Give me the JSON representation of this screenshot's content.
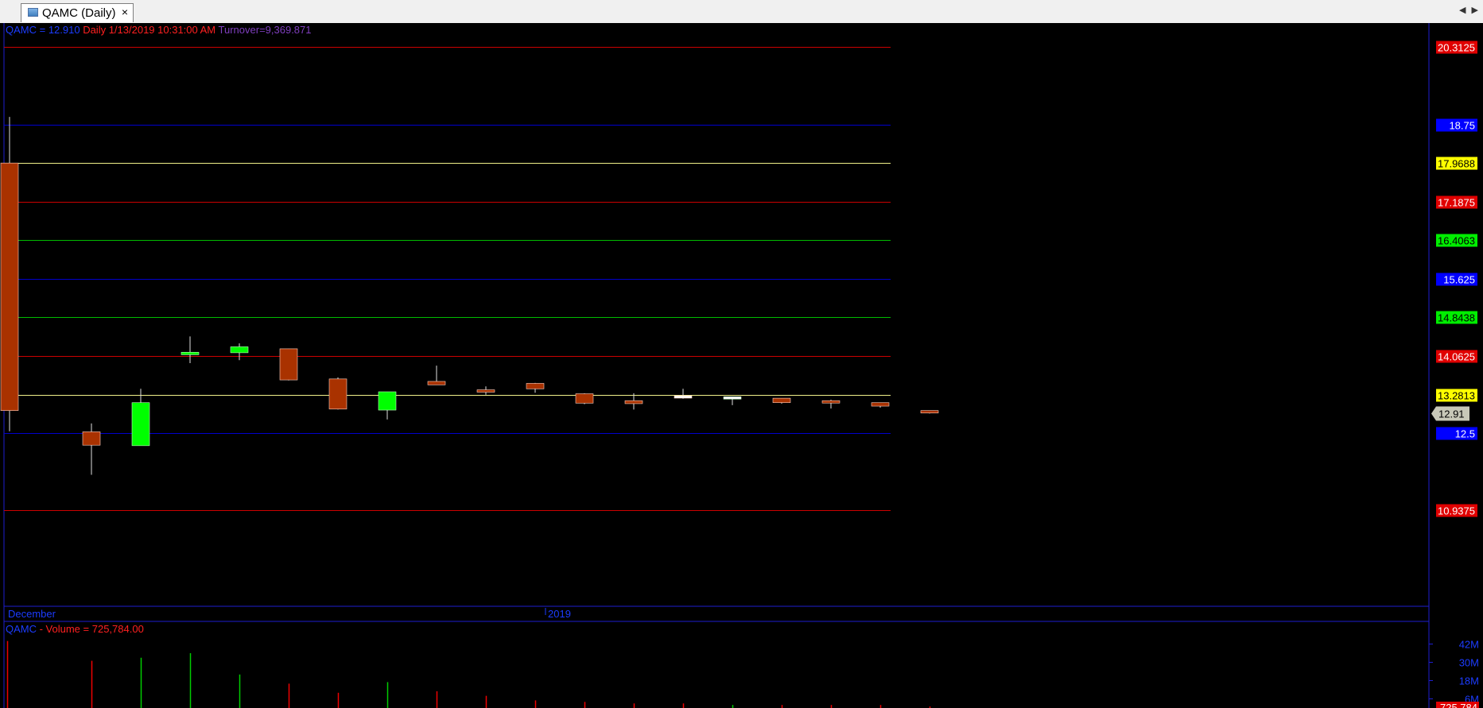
{
  "tab": {
    "title": "QAMC (Daily)",
    "close_label": "×",
    "scroll_arrows": "◀ ▶"
  },
  "header": {
    "symbol": "QAMC",
    "price_text": " =  12.910",
    "rest_text": " Daily 1/13/2019 10:31:00 AM ",
    "turnover_text": "Turnover=9,369.871"
  },
  "volume_header": {
    "symbol": "QAMC",
    "volume_text": " - Volume = 725,784.00"
  },
  "colors": {
    "background": "#000000",
    "down_candle": "#a93200",
    "up_candle": "#00ff00",
    "doji": "#ffffff",
    "wick": "#e0e0e0",
    "blue_line": "#0000cc",
    "red_line": "#cc0000",
    "yellow_line": "#f0f08a",
    "green_line": "#00bb00",
    "axis_blue": "#1e1ed0",
    "text_blue": "#1c3cff",
    "text_red": "#ff2020",
    "text_purple": "#7f3fbf"
  },
  "chart_data": {
    "type": "candlestick",
    "symbol": "QAMC",
    "interval": "Daily",
    "ylim": [
      9.0,
      20.8
    ],
    "x_labels": [
      "December",
      "2019"
    ],
    "last_price": 12.91,
    "last_price_label": "12.91",
    "candles": [
      {
        "o": 17.968,
        "h": 18.9,
        "l": 12.54,
        "c": 12.96
      },
      {
        "o": 12.53,
        "h": 12.7,
        "l": 11.66,
        "c": 12.26
      },
      {
        "o": 12.25,
        "h": 13.4,
        "l": 12.25,
        "c": 13.12
      },
      {
        "o": 14.09,
        "h": 14.46,
        "l": 13.92,
        "c": 14.14
      },
      {
        "o": 14.13,
        "h": 14.32,
        "l": 13.98,
        "c": 14.25
      },
      {
        "o": 14.21,
        "h": 14.17,
        "l": 13.57,
        "c": 13.58
      },
      {
        "o": 13.6,
        "h": 13.63,
        "l": 12.98,
        "c": 12.99
      },
      {
        "o": 12.97,
        "h": 13.32,
        "l": 12.78,
        "c": 13.34
      },
      {
        "o": 13.55,
        "h": 13.87,
        "l": 13.51,
        "c": 13.48
      },
      {
        "o": 13.38,
        "h": 13.45,
        "l": 13.28,
        "c": 13.35
      },
      {
        "o": 13.51,
        "h": 13.52,
        "l": 13.32,
        "c": 13.4
      },
      {
        "o": 13.3,
        "h": 13.31,
        "l": 13.09,
        "c": 13.11
      },
      {
        "o": 13.16,
        "h": 13.31,
        "l": 12.98,
        "c": 13.1
      },
      {
        "o": 13.26,
        "h": 13.4,
        "l": 13.2,
        "c": 13.26
      },
      {
        "o": 13.23,
        "h": 13.24,
        "l": 13.07,
        "c": 13.24
      },
      {
        "o": 13.21,
        "h": 13.19,
        "l": 13.1,
        "c": 13.12
      },
      {
        "o": 13.16,
        "h": 13.18,
        "l": 13.0,
        "c": 13.13
      },
      {
        "o": 13.12,
        "h": 13.1,
        "l": 13.02,
        "c": 13.05
      },
      {
        "o": 12.96,
        "h": 12.96,
        "l": 12.9,
        "c": 12.91
      }
    ],
    "levels": [
      {
        "value": 20.3125,
        "label": "20.3125",
        "color": "#cc0000"
      },
      {
        "value": 18.75,
        "label": "18.75",
        "color": "#0000cc"
      },
      {
        "value": 17.9688,
        "label": "17.9688",
        "color": "#f0f08a"
      },
      {
        "value": 17.1875,
        "label": "17.1875",
        "color": "#cc0000"
      },
      {
        "value": 16.4063,
        "label": "16.4063",
        "color": "#00bb00"
      },
      {
        "value": 15.625,
        "label": "15.625",
        "color": "#0000cc"
      },
      {
        "value": 14.8438,
        "label": "14.8438",
        "color": "#00bb00"
      },
      {
        "value": 14.0625,
        "label": "14.0625",
        "color": "#cc0000"
      },
      {
        "value": 13.2813,
        "label": "13.2813",
        "color": "#f0f08a"
      },
      {
        "value": 12.5,
        "label": "12.5",
        "color": "#0000cc"
      },
      {
        "value": 10.9375,
        "label": "10.9375",
        "color": "#cc0000"
      }
    ],
    "volume": {
      "unit": "M",
      "ylim": [
        0,
        48
      ],
      "ticks": [
        {
          "value": 42,
          "label": "42M"
        },
        {
          "value": 30,
          "label": "30M"
        },
        {
          "value": 18,
          "label": "18M"
        },
        {
          "value": 6,
          "label": "6M"
        }
      ],
      "last_label": "725,784",
      "values": [
        44,
        31,
        33,
        36,
        22,
        16,
        10,
        17,
        11,
        8,
        5,
        4,
        3,
        3,
        2,
        2,
        2,
        2,
        1
      ]
    }
  }
}
